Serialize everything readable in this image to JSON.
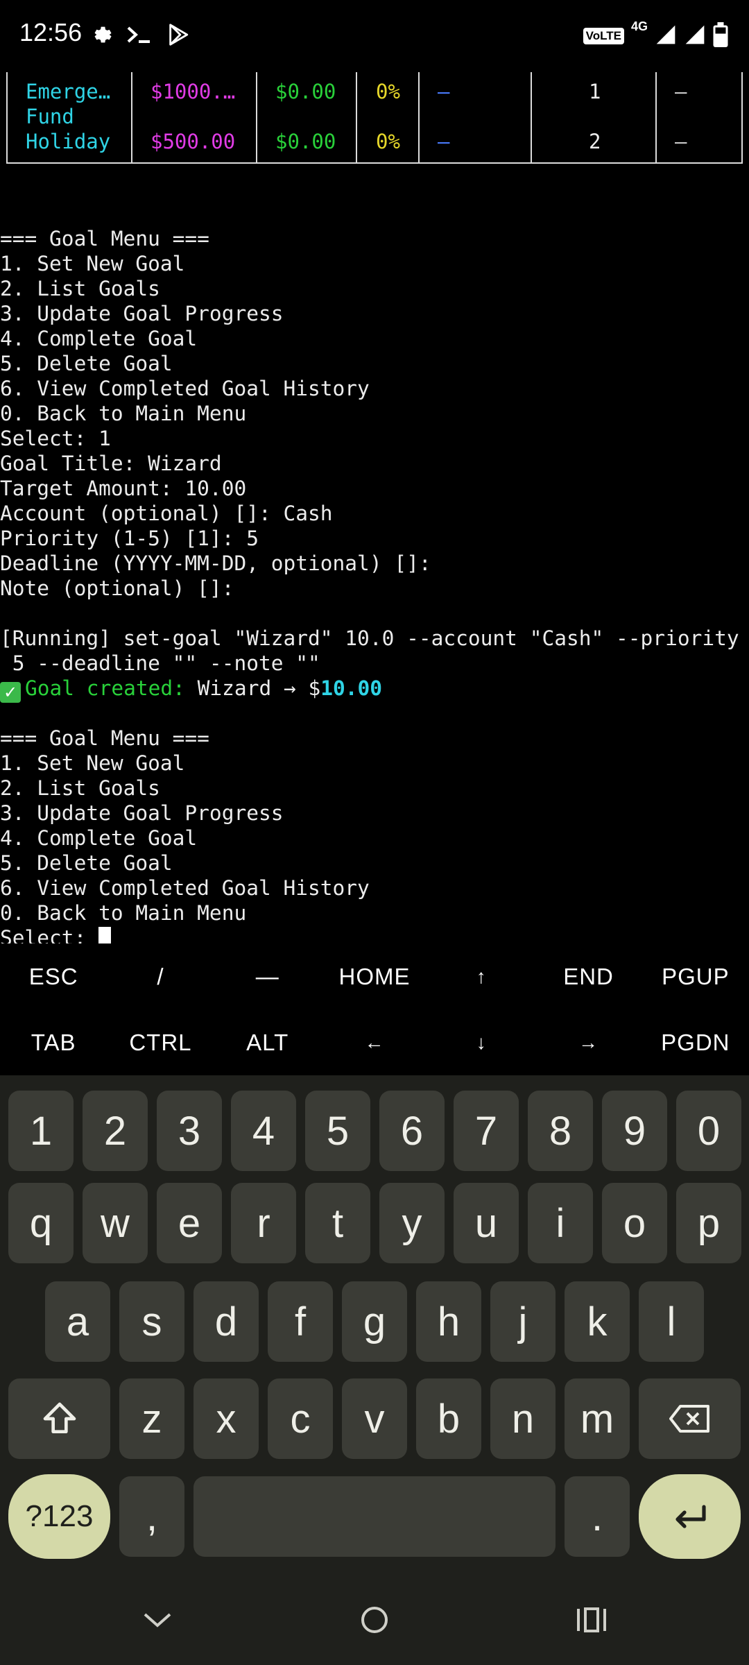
{
  "status_bar": {
    "time": "12:56",
    "left_icons": [
      "settings-icon",
      "terminal-icon",
      "play-store-icon"
    ],
    "volte": "VoLTE",
    "network": "4G",
    "right_icons": [
      "signal-icon",
      "signal-icon",
      "battery-icon"
    ]
  },
  "table": {
    "rows": [
      {
        "name_line1": "Emerge…",
        "name_line2": "Fund",
        "target": "$1000.…",
        "saved": "$0.00",
        "pct": "0%",
        "deadline": "—",
        "priority": "1",
        "note": "—"
      },
      {
        "name_line1": "Holiday",
        "name_line2": "",
        "target": "$500.00",
        "saved": "$0.00",
        "pct": "0%",
        "deadline": "—",
        "priority": "2",
        "note": "—"
      }
    ]
  },
  "terminal": {
    "lines_before": [
      "",
      "=== Goal Menu ===",
      "1. Set New Goal",
      "2. List Goals",
      "3. Update Goal Progress",
      "4. Complete Goal",
      "5. Delete Goal",
      "6. View Completed Goal History",
      "0. Back to Main Menu",
      "Select: 1",
      "Goal Title: Wizard",
      "Target Amount: 10.00",
      "Account (optional) []: Cash",
      "Priority (1-5) [1]: 5",
      "Deadline (YYYY-MM-DD, optional) []:",
      "Note (optional) []:",
      "",
      "[Running] set-goal \"Wizard\" 10.0 --account \"Cash\" --priority",
      " 5 --deadline \"\" --note \"\""
    ],
    "success": {
      "check": "✓",
      "label": "Goal created:",
      "goal": " Wizard → $",
      "amount": "10.00"
    },
    "lines_after": [
      "",
      "=== Goal Menu ===",
      "1. Set New Goal",
      "2. List Goals",
      "3. Update Goal Progress",
      "4. Complete Goal",
      "5. Delete Goal",
      "6. View Completed Goal History",
      "0. Back to Main Menu"
    ],
    "prompt": "Select: "
  },
  "extra_keys": {
    "row1": [
      "ESC",
      "/",
      "—",
      "HOME",
      "↑",
      "END",
      "PGUP"
    ],
    "row2": [
      "TAB",
      "CTRL",
      "ALT",
      "←",
      "↓",
      "→",
      "PGDN"
    ]
  },
  "keyboard": {
    "numbers": [
      "1",
      "2",
      "3",
      "4",
      "5",
      "6",
      "7",
      "8",
      "9",
      "0"
    ],
    "row_q": [
      "q",
      "w",
      "e",
      "r",
      "t",
      "y",
      "u",
      "i",
      "o",
      "p"
    ],
    "row_a": [
      "a",
      "s",
      "d",
      "f",
      "g",
      "h",
      "j",
      "k",
      "l"
    ],
    "row_z": [
      "z",
      "x",
      "c",
      "v",
      "b",
      "n",
      "m"
    ],
    "symbols_key": "?123",
    "comma": ",",
    "period": "."
  },
  "nav_bar": {
    "icons": [
      "chevron-down-icon",
      "home-circle-icon",
      "recents-icon"
    ]
  },
  "colors": {
    "keyboard_bg": "#1f201c",
    "key_bg": "#3b3c36",
    "accent_key": "#d4d9a8"
  }
}
